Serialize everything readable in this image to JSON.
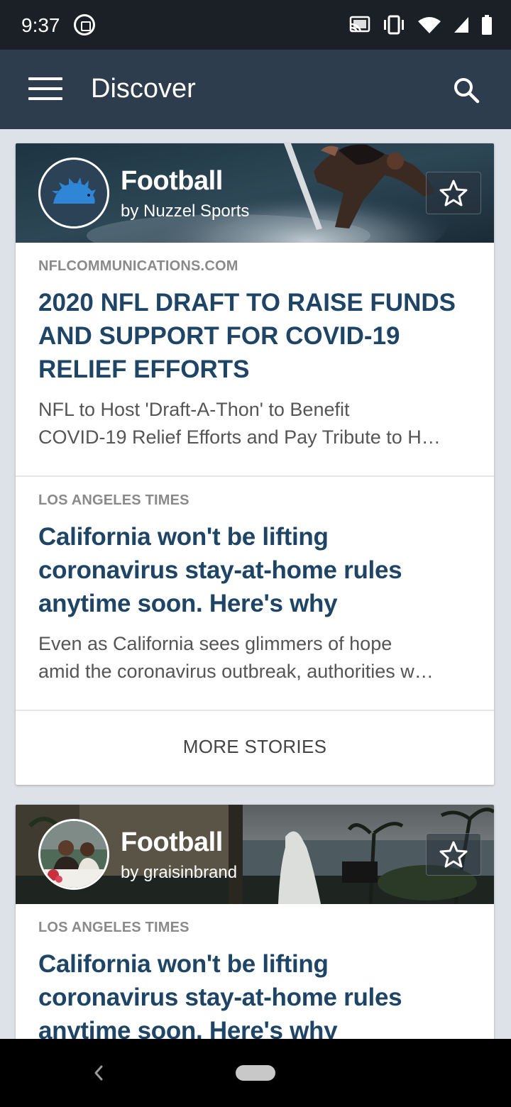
{
  "status_bar": {
    "time": "9:37"
  },
  "app_bar": {
    "title": "Discover"
  },
  "cards": [
    {
      "channel": "Football",
      "by_line": "by Nuzzel Sports",
      "stories": [
        {
          "source": "NFLCOMMUNICATIONS.COM",
          "title": "2020 NFL DRAFT TO RAISE FUNDS AND SUPPORT FOR COVID-19 RELIEF EFFORTS",
          "snippet_line1": "NFL to Host 'Draft-A-Thon' to Benefit",
          "snippet_line2": "COVID-19 Relief Efforts and Pay Tribute to H…"
        },
        {
          "source": "LOS ANGELES TIMES",
          "title": "California won't be lifting coronavirus stay-at-home rules anytime soon. Here's why",
          "snippet_line1": "Even as California sees glimmers of hope",
          "snippet_line2": "amid the coronavirus outbreak, authorities w…"
        }
      ],
      "more_label": "MORE STORIES"
    },
    {
      "channel": "Football",
      "by_line": "by graisinbrand",
      "stories": [
        {
          "source": "LOS ANGELES TIMES",
          "title": "California won't be lifting coronavirus stay-at-home rules anytime soon. Here's why"
        }
      ]
    }
  ],
  "colors": {
    "app_bar": "#2e3d4e",
    "status_bar": "#1b2027",
    "headline": "#1f4566",
    "background": "#dde2e8"
  },
  "icons": [
    "menu-icon",
    "search-icon",
    "star-icon",
    "cast-icon",
    "vibrate-icon",
    "wifi-icon",
    "signal-icon",
    "battery-icon"
  ]
}
